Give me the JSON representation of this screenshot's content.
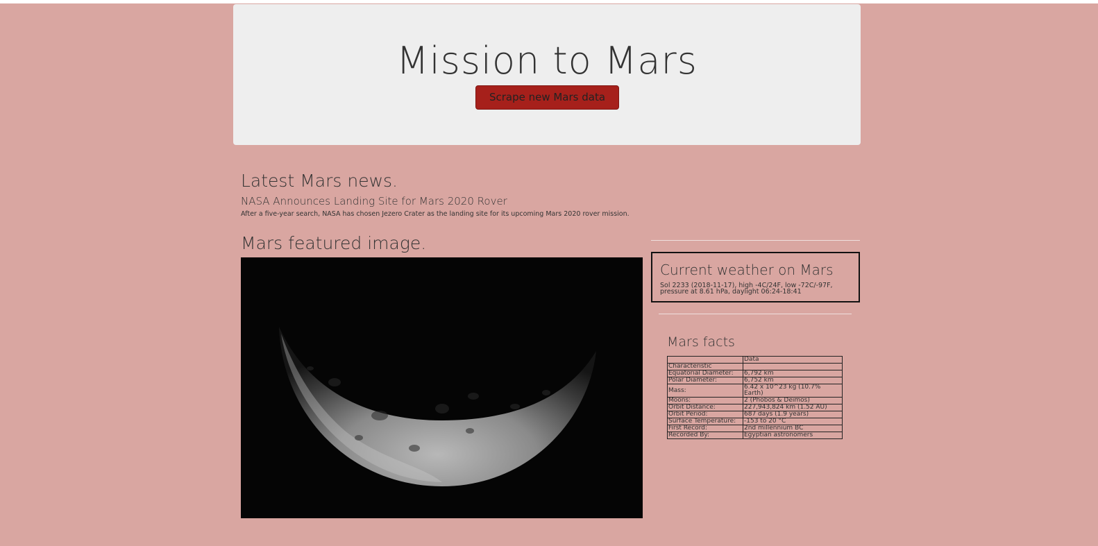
{
  "header": {
    "title": "Mission to Mars",
    "scrape_button": "Scrape new Mars data"
  },
  "news": {
    "heading": "Latest Mars news.",
    "title": "NASA Announces Landing Site for Mars 2020 Rover",
    "paragraph": "After a five-year search, NASA has chosen Jezero Crater as the landing site for its upcoming Mars 2020 rover mission."
  },
  "featured_image": {
    "heading": "Mars featured image."
  },
  "weather": {
    "heading": "Current weather on Mars",
    "text": "Sol 2233 (2018-11-17), high -4C/24F, low -72C/-97F, pressure at 8.61 hPa, daylight 06:24-18:41"
  },
  "facts": {
    "heading": "Mars facts",
    "columns": [
      "",
      "Data"
    ],
    "index_label": "Characteristic",
    "rows": [
      {
        "label": "Equatorial Diameter:",
        "value": "6,792 km"
      },
      {
        "label": "Polar Diameter:",
        "value": "6,752 km"
      },
      {
        "label": "Mass:",
        "value": "6.42 x 10^23 kg (10.7% Earth)"
      },
      {
        "label": "Moons:",
        "value": "2 (Phobos & Deimos)"
      },
      {
        "label": "Orbit Distance:",
        "value": "227,943,824 km (1.52 AU)"
      },
      {
        "label": "Orbit Period:",
        "value": "687 days (1.9 years)"
      },
      {
        "label": "Surface Temperature:",
        "value": "-153 to 20 °C"
      },
      {
        "label": "First Record:",
        "value": "2nd millennium BC"
      },
      {
        "label": "Recorded By:",
        "value": "Egyptian astronomers"
      }
    ]
  }
}
